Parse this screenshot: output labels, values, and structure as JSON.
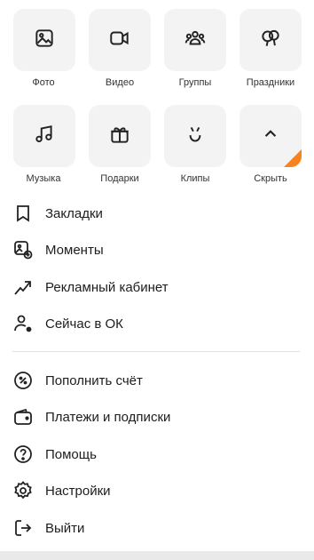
{
  "quick_actions": {
    "row1": [
      {
        "label": "Фото",
        "icon": "photo-icon"
      },
      {
        "label": "Видео",
        "icon": "video-icon"
      },
      {
        "label": "Группы",
        "icon": "groups-icon"
      },
      {
        "label": "Праздники",
        "icon": "balloons-icon"
      }
    ],
    "row2": [
      {
        "label": "Музыка",
        "icon": "music-note-icon"
      },
      {
        "label": "Подарки",
        "icon": "gift-icon"
      },
      {
        "label": "Клипы",
        "icon": "clips-icon"
      },
      {
        "label": "Скрыть",
        "icon": "chevron-up-icon"
      }
    ]
  },
  "menu": {
    "group1": [
      {
        "label": "Закладки",
        "icon": "bookmark-icon"
      },
      {
        "label": "Моменты",
        "icon": "moments-icon"
      },
      {
        "label": "Рекламный кабинет",
        "icon": "ads-trend-icon"
      },
      {
        "label": "Сейчас в ОК",
        "icon": "user-online-icon"
      }
    ],
    "group2": [
      {
        "label": "Пополнить счёт",
        "icon": "percent-icon"
      },
      {
        "label": "Платежи и подписки",
        "icon": "wallet-icon"
      },
      {
        "label": "Помощь",
        "icon": "help-icon"
      },
      {
        "label": "Настройки",
        "icon": "gear-icon"
      },
      {
        "label": "Выйти",
        "icon": "logout-icon"
      }
    ]
  },
  "colors": {
    "accent": "#f7831e",
    "tile_bg": "#f3f3f3",
    "text": "#1d1d1d"
  }
}
